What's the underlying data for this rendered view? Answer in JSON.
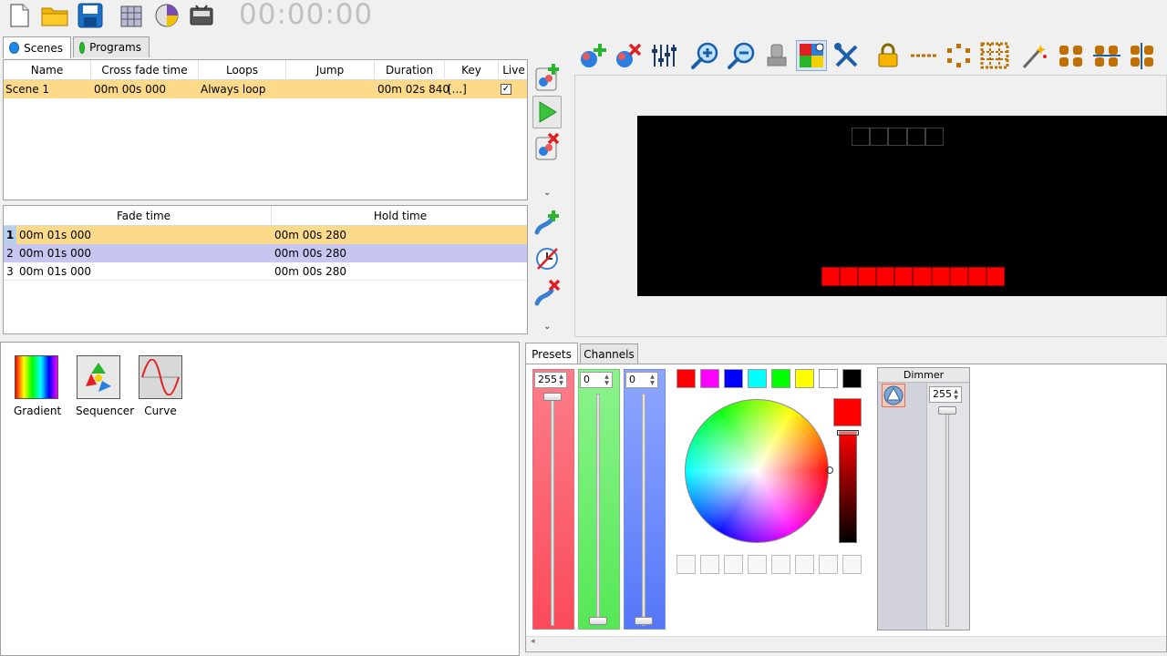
{
  "toolbar": {
    "icons": [
      "new-file-icon",
      "open-folder-icon",
      "save-icon",
      "fixture-grid-icon",
      "color-palette-icon",
      "dmx-settings-icon"
    ],
    "timer": "00:00:00"
  },
  "tabs": [
    {
      "label": "Scenes",
      "color": "#1e88e5",
      "active": true
    },
    {
      "label": "Programs",
      "color": "#22c02a",
      "active": false
    }
  ],
  "scenes_table": {
    "columns": [
      "Name",
      "Cross fade time",
      "Loops",
      "Jump",
      "Duration",
      "Key",
      "Live"
    ],
    "rows": [
      {
        "name": "Scene 1",
        "crossfade": "00m 00s 000",
        "loops": "Always loop",
        "jump": "",
        "duration": "00m 02s 840",
        "key": "[...]",
        "live": true
      }
    ]
  },
  "steps_table": {
    "columns": [
      "Fade time",
      "Hold time"
    ],
    "rows": [
      {
        "num": "1",
        "fade": "00m 01s 000",
        "hold": "00m 00s 280"
      },
      {
        "num": "2",
        "fade": "00m 01s 000",
        "hold": "00m 00s 280"
      },
      {
        "num": "3",
        "fade": "00m 01s 000",
        "hold": "00m 00s 280"
      }
    ]
  },
  "effects": [
    {
      "label": "Gradient"
    },
    {
      "label": "Sequencer"
    },
    {
      "label": "Curve"
    }
  ],
  "bottom_tabs": [
    "Presets",
    "Channels"
  ],
  "rgb": {
    "red": "255",
    "green": "0",
    "blue": "0"
  },
  "dimmer": {
    "label": "Dimmer",
    "value": "255"
  },
  "color_swatches": [
    "#ff0000",
    "#ff00ff",
    "#0000ff",
    "#00ffff",
    "#00ff00",
    "#ffff00",
    "#ffffff",
    "#000000"
  ],
  "current_color": "#ff0000"
}
